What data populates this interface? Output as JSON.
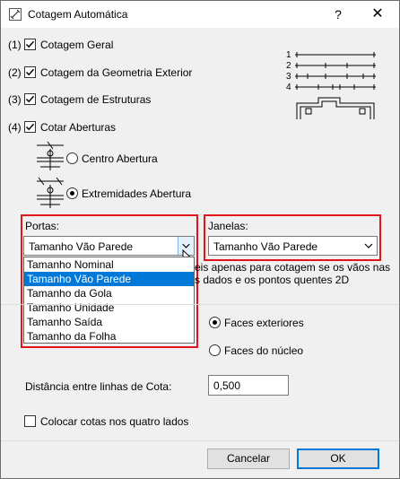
{
  "window": {
    "title": "Cotagem Automática",
    "help": "?",
    "close": "✕"
  },
  "options": [
    {
      "num": "(1)",
      "label": "Cotagem Geral",
      "checked": true
    },
    {
      "num": "(2)",
      "label": "Cotagem da Geometria Exterior",
      "checked": true
    },
    {
      "num": "(3)",
      "label": "Cotagem de Estruturas",
      "checked": true
    },
    {
      "num": "(4)",
      "label": "Cotar Aberturas",
      "checked": true
    }
  ],
  "openings": {
    "center_label": "Centro Abertura",
    "ends_label": "Extremidades Abertura",
    "selected": "ends"
  },
  "legend_numbers": [
    "1",
    "2",
    "3",
    "4"
  ],
  "portas": {
    "label": "Portas:",
    "value": "Tamanho Vão Parede",
    "options": [
      "Tamanho Nominal",
      "Tamanho Vão Parede",
      "Tamanho da Gola",
      "Tamanho Unidade",
      "Tamanho Saída",
      "Tamanho da Folha"
    ],
    "selected_index": 1
  },
  "janelas": {
    "label": "Janelas:",
    "value": "Tamanho Vão Parede"
  },
  "note_line1": "eis apenas para cotagem se os vãos nas",
  "note_line2": "s dados e os pontos quentes 2D",
  "faces": {
    "exteriores": "Faces exteriores",
    "nucleo": "Faces do núcleo",
    "selected": "exteriores"
  },
  "distance": {
    "label": "Distância entre linhas de Cota:",
    "value": "0,500"
  },
  "four_sides": {
    "label": "Colocar cotas nos quatro lados",
    "checked": false
  },
  "buttons": {
    "cancel": "Cancelar",
    "ok": "OK"
  }
}
